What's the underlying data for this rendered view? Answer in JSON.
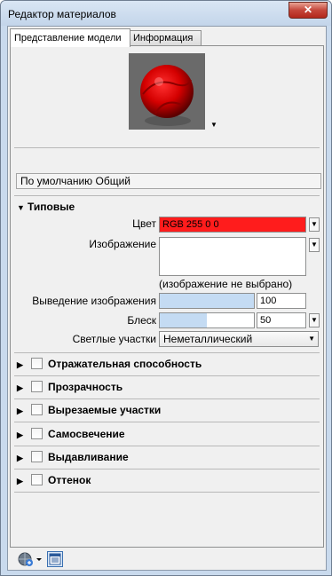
{
  "window": {
    "title": "Редактор материалов",
    "close_symbol": "✕"
  },
  "tabs": [
    {
      "label": "Представление модели",
      "active": true
    },
    {
      "label": "Информация",
      "active": false
    }
  ],
  "preview": {
    "sphere_color": "#e00000",
    "dropdown_icon": "triangle-down-icon"
  },
  "material_name": "По умолчанию Общий",
  "generic": {
    "header": "Типовые",
    "color_label": "Цвет",
    "color_value": "RGB 255 0 0",
    "color_swatch": "#ff1c1c",
    "image_label": "Изображение",
    "image_status": "(изображение не выбрано)",
    "image_fade_label": "Выведение изображения",
    "image_fade_value": "100",
    "image_fade_level": 1.0,
    "glossiness_label": "Блеск",
    "glossiness_value": "50",
    "glossiness_level": 0.5,
    "highlights_label": "Светлые участки",
    "highlights_value": "Неметаллический"
  },
  "sections": [
    {
      "label": "Отражательная способность"
    },
    {
      "label": "Прозрачность"
    },
    {
      "label": "Вырезаемые участки"
    },
    {
      "label": "Самосвечение"
    },
    {
      "label": "Выдавливание"
    },
    {
      "label": "Оттенок"
    }
  ],
  "bottom": {
    "left_icon": "globe-add-icon",
    "right_icon": "list-view-icon"
  }
}
